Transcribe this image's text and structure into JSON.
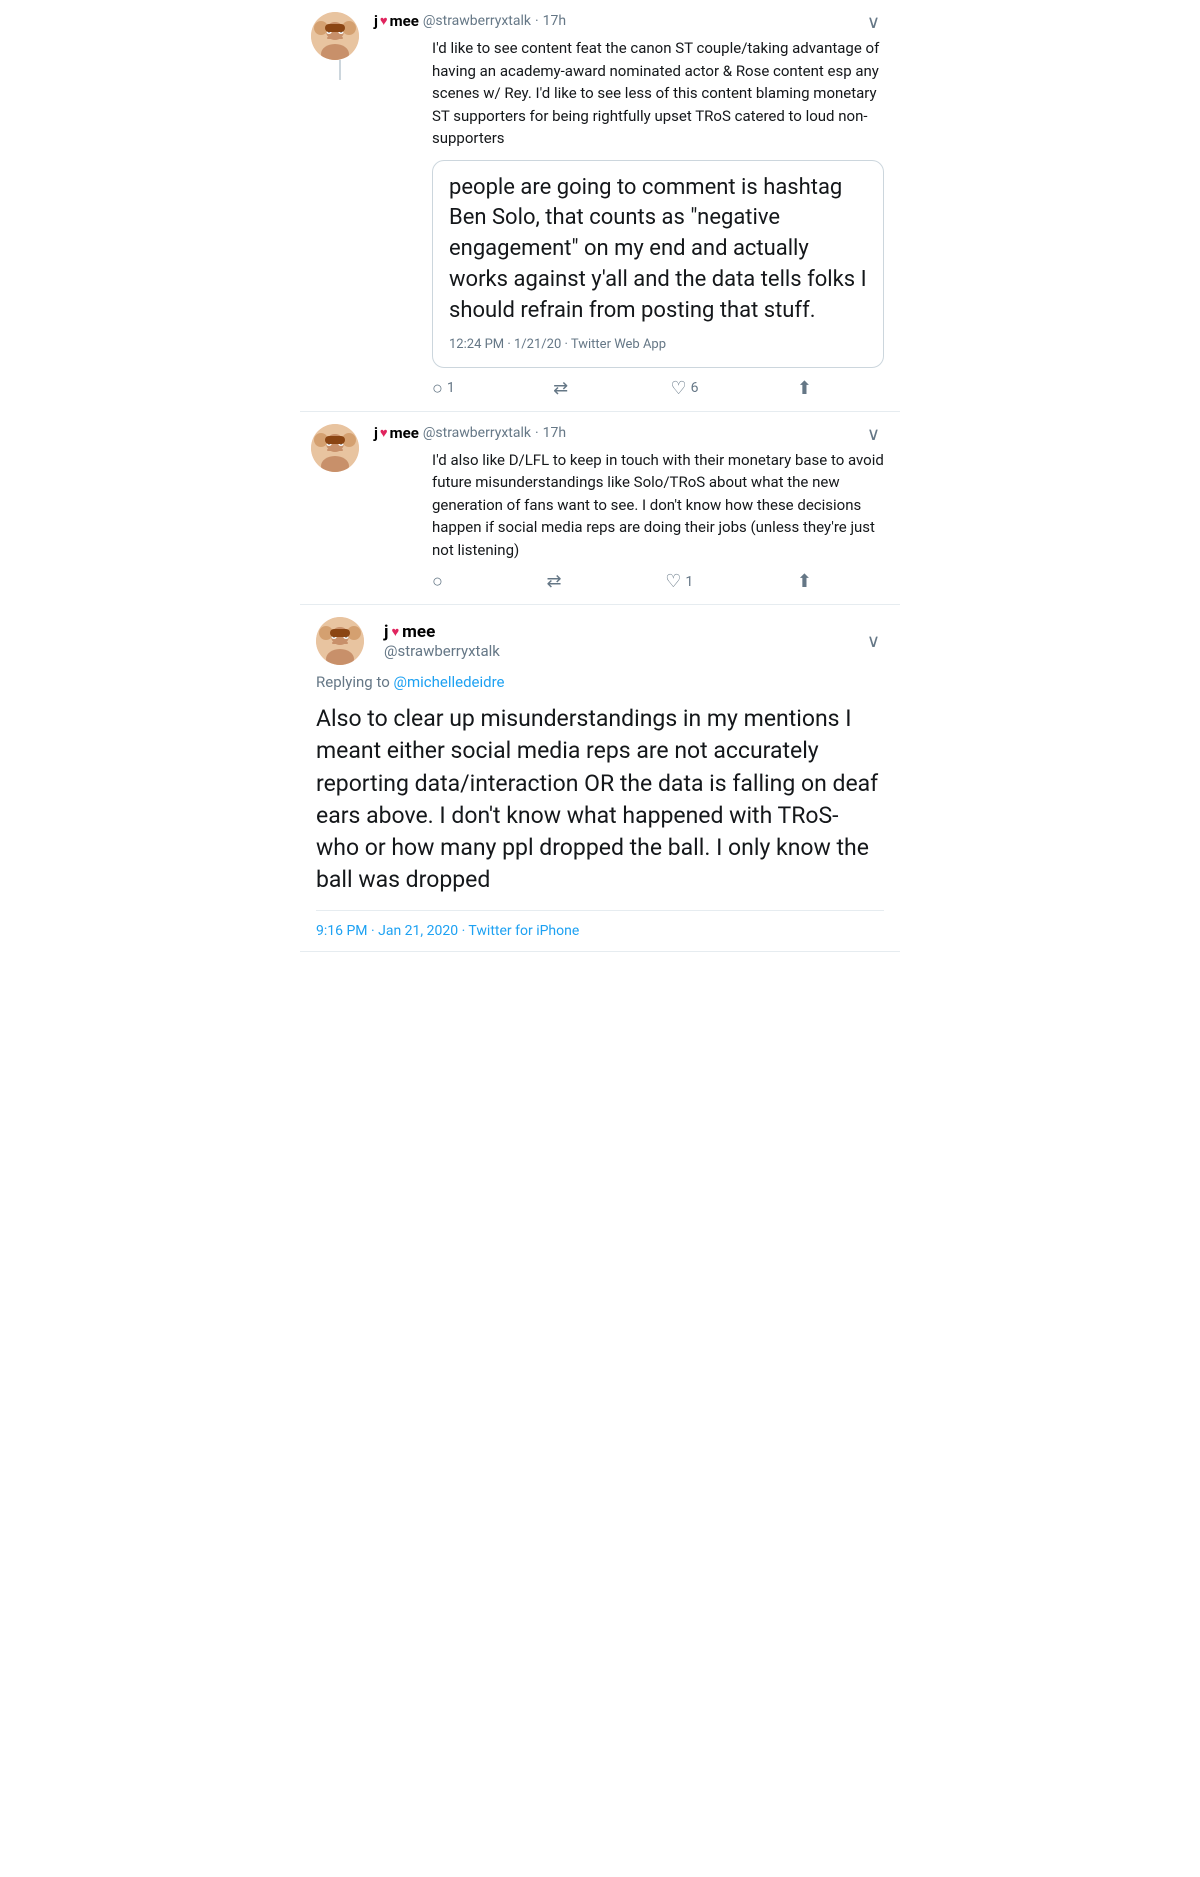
{
  "tweet1": {
    "display_name": "j",
    "heart": "♥",
    "name_suffix": "mee",
    "username": "@strawberryxtalk",
    "separator": "·",
    "timestamp": "17h",
    "body": "I'd like to see content feat the canon ST couple/taking advantage of having an academy-award nominated actor & Rose content esp any scenes w/ Rey. I'd like to see less of this content blaming monetary ST supporters for being rightfully upset TRoS catered to loud non-supporters",
    "quoted_text": "people are going to comment is hashtag Ben Solo, that counts as \"negative engagement\" on my end and actually works against y'all and the data tells folks I should refrain from posting that stuff.",
    "quoted_timestamp": "12:24 PM · 1/21/20 · Twitter Web App",
    "actions": {
      "reply": "1",
      "retweet": "",
      "like": "6",
      "share": ""
    }
  },
  "tweet2": {
    "display_name": "j",
    "heart": "♥",
    "name_suffix": "mee",
    "username": "@strawberryxtalk",
    "separator": "·",
    "timestamp": "17h",
    "body": "I'd also like D/LFL to keep in touch with their monetary base to avoid future misunderstandings like Solo/TRoS about what the new generation of fans want to see. I don't know how these decisions happen if social media reps are doing their jobs (unless they're just not listening)",
    "actions": {
      "reply": "",
      "retweet": "",
      "like": "1",
      "share": ""
    }
  },
  "tweet3": {
    "display_name": "j",
    "heart": "♥",
    "name_suffix": "mee",
    "username": "@strawberryxtalk",
    "replying_to": "@michelledeidre",
    "body": "Also to clear up misunderstandings in my mentions I meant either social media reps are not accurately reporting data/interaction OR the data is falling on deaf ears above. I don't know what happened with TRoS- who or how many ppl dropped the ball. I only know the ball was dropped",
    "timestamp_full": "9:16 PM · Jan 21, 2020 · Twitter for iPhone"
  },
  "icons": {
    "reply": "○",
    "retweet": "⇄",
    "like": "♡",
    "share": "⬆",
    "chevron": "∨"
  }
}
